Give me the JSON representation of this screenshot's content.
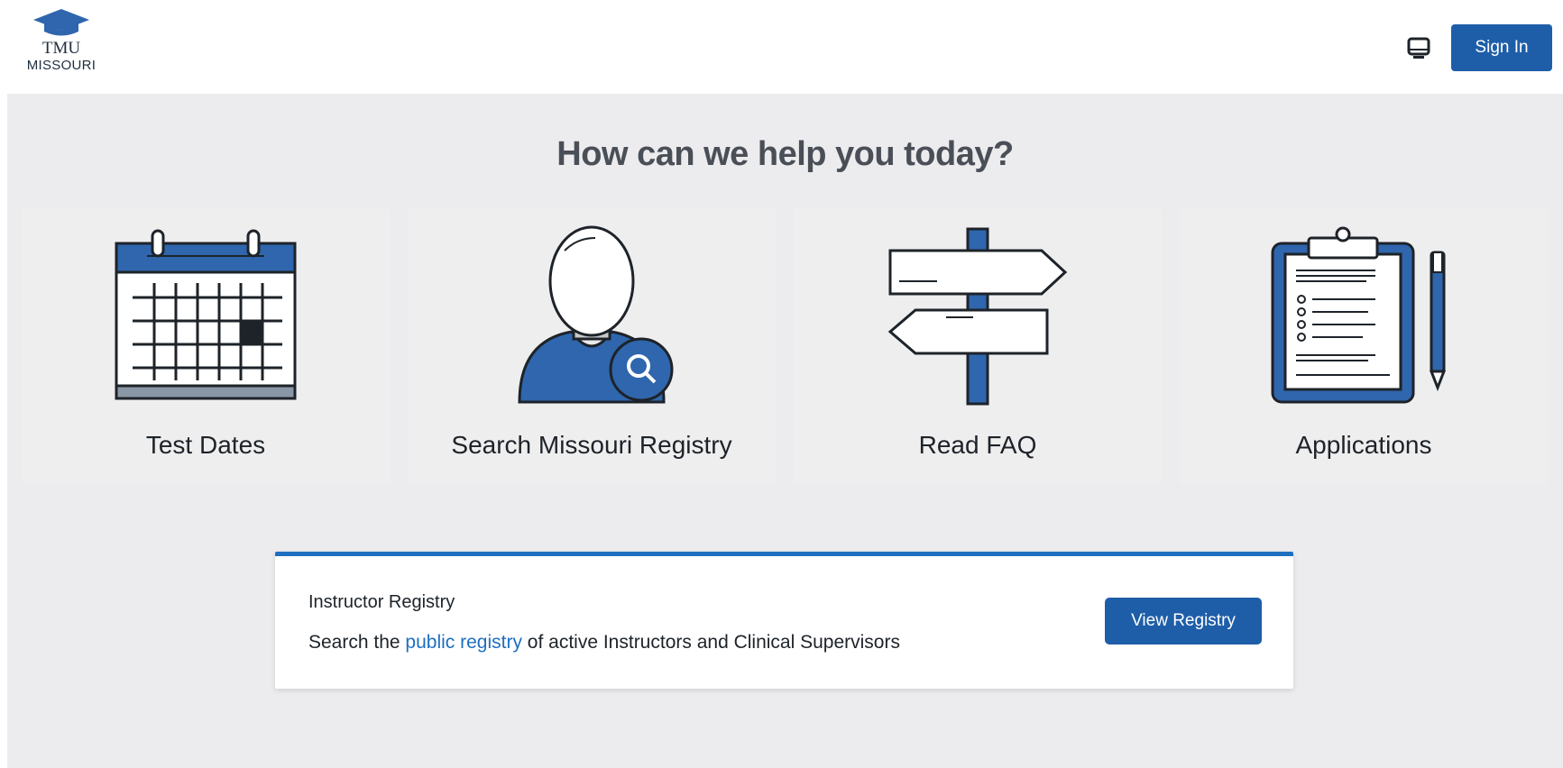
{
  "header": {
    "logo_line1": "TMU",
    "logo_line2": "MISSOURI",
    "monitor_icon": "monitor-icon",
    "signin_label": "Sign In"
  },
  "main": {
    "headline": "How can we help you today?",
    "cards": [
      {
        "label": "Test Dates",
        "icon": "calendar-icon"
      },
      {
        "label": "Search Missouri Registry",
        "icon": "person-search-icon"
      },
      {
        "label": "Read FAQ",
        "icon": "signpost-icon"
      },
      {
        "label": "Applications",
        "icon": "clipboard-icon"
      }
    ],
    "registry": {
      "title": "Instructor Registry",
      "desc_before": "Search the ",
      "link_text": "public registry",
      "desc_after": " of active Instructors and Clinical Supervisors",
      "button_label": "View Registry"
    }
  },
  "colors": {
    "primary": "#1e5ea8",
    "link": "#1e6fc0",
    "icon_blue": "#2f66ad",
    "background": "#ecebee"
  }
}
